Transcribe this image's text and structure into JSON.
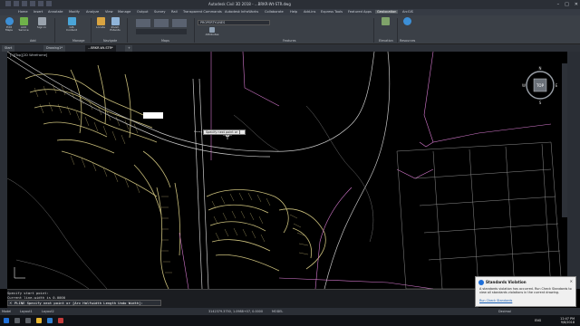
{
  "window": {
    "title": "Autodesk Civil 3D 2018 - ...BRKR-Wt-STR.dwg",
    "controls": [
      "–",
      "□",
      "✕"
    ]
  },
  "ribbon_tabs": [
    {
      "label": "Home",
      "active": false
    },
    {
      "label": "Insert",
      "active": false
    },
    {
      "label": "Annotate",
      "active": false
    },
    {
      "label": "Modify",
      "active": false
    },
    {
      "label": "Analyze",
      "active": false
    },
    {
      "label": "View",
      "active": false
    },
    {
      "label": "Manage",
      "active": false
    },
    {
      "label": "Output",
      "active": false
    },
    {
      "label": "Survey",
      "active": false
    },
    {
      "label": "Rail",
      "active": false
    },
    {
      "label": "Transparent Commands",
      "active": false
    },
    {
      "label": "Autodesk InfraWorks",
      "active": false
    },
    {
      "label": "Collaborate",
      "active": false
    },
    {
      "label": "Help",
      "active": false
    },
    {
      "label": "Add-ins",
      "active": false
    },
    {
      "label": "Express Tools",
      "active": false
    },
    {
      "label": "Featured Apps",
      "active": false
    },
    {
      "label": "Geolocation",
      "active": true
    },
    {
      "label": "ArcGIS",
      "active": false
    }
  ],
  "ribbon": {
    "buttons": [
      {
        "label": "Edit Maps",
        "icon": "globe-icon"
      },
      {
        "label": "Add Service",
        "icon": "add-service-icon"
      },
      {
        "label": "Sign In",
        "icon": "sign-in-icon"
      },
      {
        "label": "GIS Content",
        "icon": "gis-content-icon"
      },
      {
        "label": "Locate",
        "icon": "locate-icon"
      },
      {
        "label": "Zoom Extents",
        "icon": "zoom-extents-icon"
      },
      {
        "label": "Attributes",
        "icon": "attributes-icon"
      },
      {
        "label": "Elevation",
        "icon": "elevation-icon"
      },
      {
        "label": "Resources",
        "icon": "help-icon"
      }
    ],
    "property_box": "PROPERTYLINES",
    "panels": [
      "Add",
      "Manage",
      "Navigate",
      "Maps",
      "Features",
      "Elevation",
      "Resources"
    ]
  },
  "doc_tabs": [
    {
      "label": "Start",
      "active": false
    },
    {
      "label": "Drawing1*",
      "active": false
    },
    {
      "label": "...BRKR-Wt-STR*",
      "active": true
    }
  ],
  "viewport": {
    "label": "[–][Top][2D Wireframe]",
    "tooltip": "Specify next point or"
  },
  "navcube": {
    "top": "TOP",
    "n": "N",
    "s": "S",
    "e": "E",
    "w": "W"
  },
  "command": {
    "history": [
      "Specify start point:",
      "Current line-width is 0.0000"
    ],
    "prompt": "PLINE Specify next point or [Arc Halfwidth Length Undo Width]:"
  },
  "status": {
    "coords": "3142379.3750, 1.0988+07, 0.0000",
    "model": "MODEL",
    "units": "Decimal",
    "layout_tabs": [
      "Model",
      "Layout1",
      "Layout2"
    ]
  },
  "taskbar": {
    "lang": "ENG",
    "time": "12:47 PM",
    "date": "9/8/2018"
  },
  "balloon": {
    "title": "Standards Violation",
    "body": "A standards violation has occurred. Run Check Standards to view all standards violations in the current drawing.",
    "link": "Run Check Standards"
  },
  "colors": {
    "background": "#000000",
    "ribbon": "#3b4047",
    "accent": "#53595f",
    "parcel": "#c8bd7a",
    "boundary": "#d77ad0",
    "road": "#c8c8c8"
  }
}
